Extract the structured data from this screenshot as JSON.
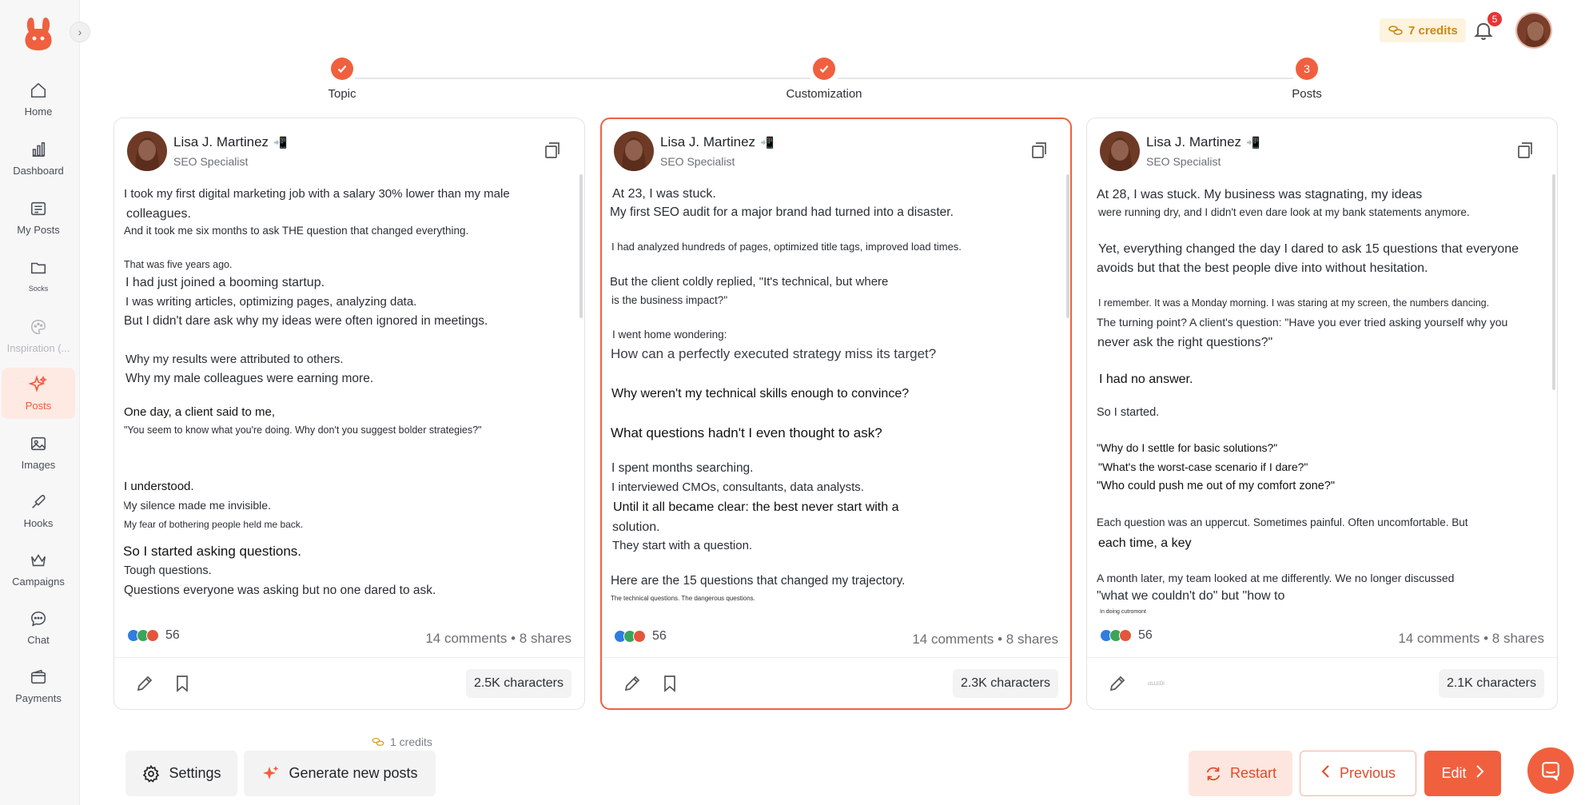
{
  "sidebar": {
    "items": [
      {
        "label": "Home",
        "icon": "home-icon"
      },
      {
        "label": "Dashboard",
        "icon": "bar-chart-icon"
      },
      {
        "label": "My Posts",
        "icon": "list-icon"
      },
      {
        "label": "Socks",
        "icon": "folder-icon"
      },
      {
        "label": "Inspiration (...",
        "icon": "palette-icon"
      },
      {
        "label": "Posts",
        "icon": "sparkle-icon"
      },
      {
        "label": "Images",
        "icon": "image-icon"
      },
      {
        "label": "Hooks",
        "icon": "hook-icon"
      },
      {
        "label": "Campaigns",
        "icon": "crown-icon"
      },
      {
        "label": "Chat",
        "icon": "chat-icon"
      },
      {
        "label": "Payments",
        "icon": "wallet-icon"
      }
    ]
  },
  "topbar": {
    "credits": "7 credits",
    "notifications": "5"
  },
  "stepper": {
    "steps": [
      {
        "label": "Topic",
        "state": "done"
      },
      {
        "label": "Customization",
        "state": "done"
      },
      {
        "label": "Posts",
        "number": "3",
        "state": "current"
      }
    ]
  },
  "cards": [
    {
      "author": "Lisa J. Martinez",
      "role": "SEO Specialist",
      "lines": [
        "I took my first digital marketing job with a salary 30% lower than my male",
        "colleagues.",
        "And it took me six months to ask THE question that changed everything.",
        "That was five years ago.",
        "I had just joined a booming startup.",
        "I was writing articles, optimizing pages, analyzing data.",
        "But I didn't dare ask why my ideas were often ignored in meetings.",
        "Why my results were attributed to others.",
        "Why my male colleagues were earning more.",
        "One day, a client said to me,",
        "\"You seem to know what you're doing. Why don't you suggest bolder strategies?\"",
        "I understood.",
        "My silence made me invisible.",
        "My fear of bothering people held me back.",
        "So I started asking questions.",
        "Tough questions.",
        "Questions everyone was asking but no one dared to ask."
      ],
      "reactions": "56",
      "engagement": "14 comments • 8 shares",
      "characters": "2.5K characters",
      "footer_tiny": ""
    },
    {
      "author": "Lisa J. Martinez",
      "role": "SEO Specialist",
      "lines": [
        "At 23, I was stuck.",
        "My first SEO audit for a major brand had turned into a disaster.",
        "I had analyzed hundreds of pages, optimized title tags, improved load times.",
        "But the client coldly replied, \"It's technical, but where",
        "is the business impact?\"",
        "I went home wondering:",
        "How can a perfectly executed strategy miss its target?",
        "Why weren't my technical skills enough to convince?",
        "What questions hadn't I even thought to ask?",
        "I spent months searching.",
        "I interviewed CMOs, consultants, data analysts.",
        "Until it all became clear: the best never start with a",
        "solution.",
        "They start with a question.",
        "Here are the 15 questions that changed my trajectory.",
        "The technical questions. The dangerous questions."
      ],
      "reactions": "56",
      "engagement": "14 comments • 8 shares",
      "characters": "2.3K characters",
      "footer_tiny": ""
    },
    {
      "author": "Lisa J. Martinez",
      "role": "SEO Specialist",
      "lines": [
        "At 28, I was stuck. My business was stagnating, my ideas",
        "were running dry, and I didn't even dare look at my bank statements anymore.",
        "Yet, everything changed the day I dared to ask 15 questions that everyone",
        "avoids but that the best people dive into without hesitation.",
        "I remember. It was a Monday morning. I was staring at my screen, the numbers dancing.",
        "The turning point? A client's question: \"Have you ever tried asking yourself why you",
        "never ask the right questions?\"",
        "I had no answer.",
        "So I started.",
        "\"Why do I settle for basic solutions?\"",
        "\"What's the worst-case scenario if I dare?\"",
        "\"Who could push me out of my comfort zone?\"",
        "Each question was an uppercut. Sometimes painful. Often uncomfortable. But",
        "each time, a key",
        "A month later, my team looked at me differently. We no longer discussed",
        "\"what we couldn't do\" but \"how to",
        "In doing cutromont"
      ],
      "reactions": "56",
      "engagement": "14 comments • 8 shares",
      "characters": "2.1K characters",
      "footer_tiny": "clLLEDl"
    }
  ],
  "bottom": {
    "credits": "1 credits",
    "settings": "Settings",
    "generate": "Generate new posts",
    "restart": "Restart",
    "previous": "Previous",
    "edit": "Edit"
  }
}
